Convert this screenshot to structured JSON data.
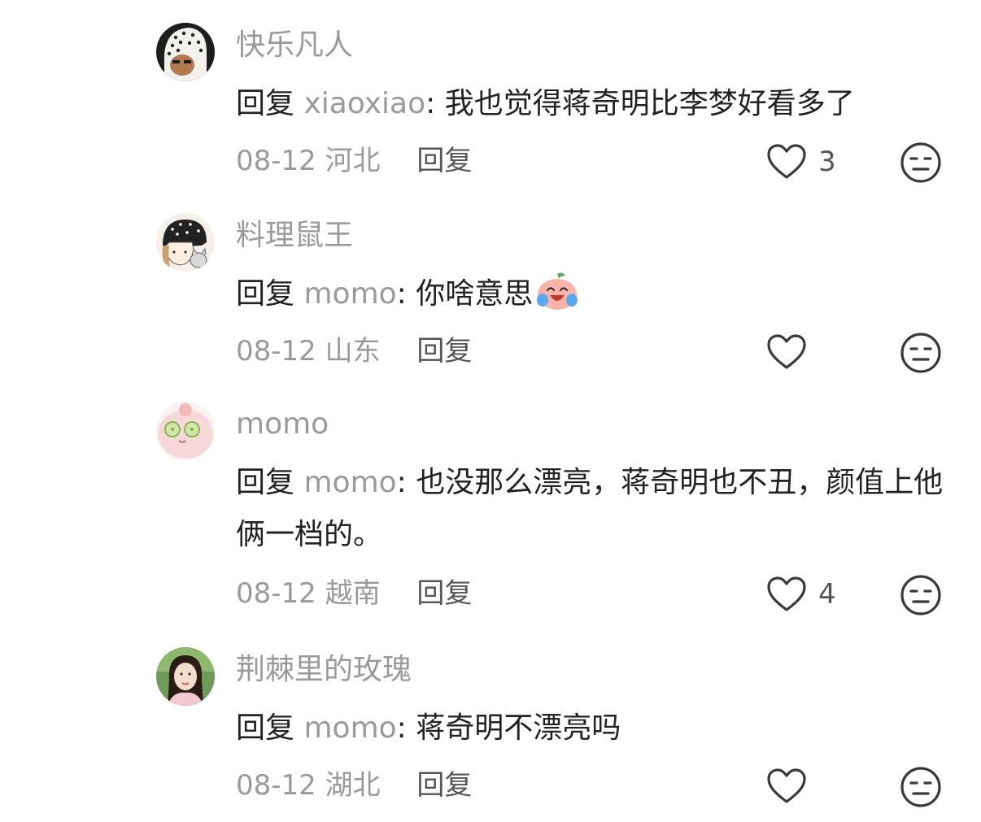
{
  "reply_prefix": "回复",
  "reply_action": "回复",
  "comments": [
    {
      "username": "快乐凡人",
      "reply_to": "xiaoxiao",
      "text": "我也觉得蒋奇明比李梦好看多了",
      "date": "08-12",
      "location": "河北",
      "likes": "3",
      "avatar": "person-in-polka-dot-hood",
      "avatar_color": "#2a2a2a"
    },
    {
      "username": "料理鼠王",
      "reply_to": "momo",
      "text": "你啥意思",
      "emoji": "laughing-crying-peach-emoji",
      "date": "08-12",
      "location": "山东",
      "likes": "",
      "avatar": "cartoon-girl-with-cat",
      "avatar_color": "#f4efe6"
    },
    {
      "username": "momo",
      "reply_to": "momo",
      "text": "也没那么漂亮，蒋奇明也不丑，颜值上他俩一档的。",
      "date": "08-12",
      "location": "越南",
      "likes": "4",
      "avatar": "pink-blob-with-cucumber-eyes",
      "avatar_color": "#f6d9d9"
    },
    {
      "username": "荆棘里的玫瑰",
      "reply_to": "momo",
      "text": "蒋奇明不漂亮吗",
      "date": "08-12",
      "location": "湖北",
      "likes": "",
      "avatar": "woman-portrait-green-background",
      "avatar_color": "#6f9a5a"
    }
  ],
  "icons": {
    "like": "heart-outline-icon",
    "dislike": "unamused-face-icon"
  }
}
